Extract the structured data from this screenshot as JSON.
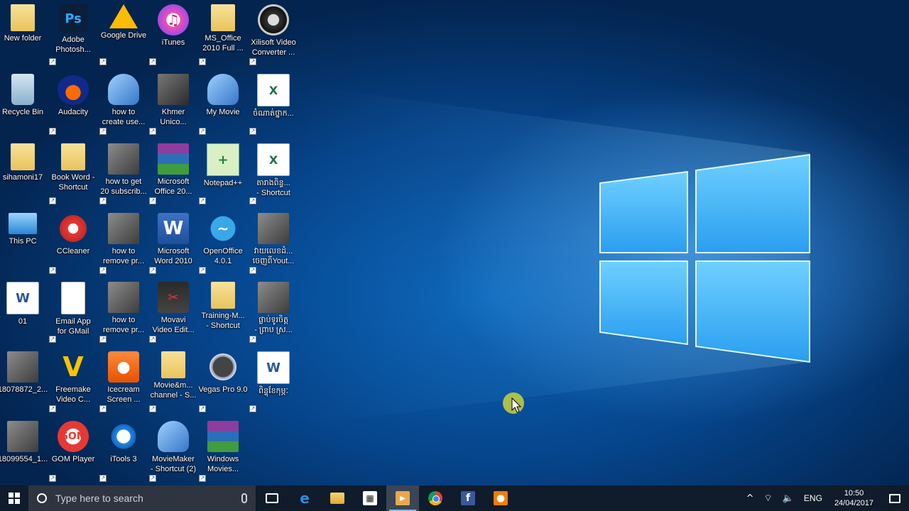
{
  "desktop": {
    "icons": [
      {
        "label": "New folder",
        "icon": "folder-icon",
        "glyph": ""
      },
      {
        "label": "Adobe\nPhotosh...",
        "icon": "photoshop-icon",
        "glyph": "Ps"
      },
      {
        "label": "Google Drive",
        "icon": "google-drive-icon",
        "glyph": ""
      },
      {
        "label": "iTunes",
        "icon": "itunes-icon",
        "glyph": "♫"
      },
      {
        "label": "MS_Office\n2010 Full ...",
        "icon": "folder-icon",
        "glyph": ""
      },
      {
        "label": "Xilisoft Video\nConverter ...",
        "icon": "film-reel-icon",
        "glyph": ""
      },
      {
        "label": "Recycle Bin",
        "icon": "recycle-bin-icon",
        "glyph": ""
      },
      {
        "label": "Audacity",
        "icon": "audacity-icon",
        "glyph": ""
      },
      {
        "label": "how to\ncreate use...",
        "icon": "moviemaker-icon",
        "glyph": ""
      },
      {
        "label": "Khmer\nUnico...",
        "icon": "keyboard-photo-icon",
        "glyph": ""
      },
      {
        "label": "My Movie",
        "icon": "moviemaker-icon",
        "glyph": ""
      },
      {
        "label": "ចំណាត់ថ្នាក...",
        "icon": "excel-file-icon",
        "glyph": "X"
      },
      {
        "label": "sihamoni17",
        "icon": "folder-icon",
        "glyph": ""
      },
      {
        "label": "Book Word -\nShortcut",
        "icon": "folder-icon",
        "glyph": ""
      },
      {
        "label": "how to get\n20 subscrib...",
        "icon": "video-file-icon",
        "glyph": ""
      },
      {
        "label": "Microsoft\nOffice 20...",
        "icon": "winrar-icon",
        "glyph": ""
      },
      {
        "label": "Notepad++",
        "icon": "notepad-plus-icon",
        "glyph": "+"
      },
      {
        "label": "តារាងពិន្ទ...\n- Shortcut",
        "icon": "excel-file-icon",
        "glyph": "X"
      },
      {
        "label": "This PC",
        "icon": "computer-icon",
        "glyph": ""
      },
      {
        "label": "CCleaner",
        "icon": "ccleaner-icon",
        "glyph": ""
      },
      {
        "label": "how to\nremove pr...",
        "icon": "video-file-icon",
        "glyph": ""
      },
      {
        "label": "Microsoft\nWord 2010",
        "icon": "word-icon",
        "glyph": "W"
      },
      {
        "label": "OpenOffice\n4.0.1",
        "icon": "openoffice-icon",
        "glyph": "~"
      },
      {
        "label": "វាយលេខដំ...\nចេញពីYout...",
        "icon": "video-file-icon",
        "glyph": ""
      },
      {
        "label": "01",
        "icon": "word-file-icon",
        "glyph": "W"
      },
      {
        "label": "Email App\nfor GMail",
        "icon": "blank-file-icon",
        "glyph": ""
      },
      {
        "label": "how to\nremove pr...",
        "icon": "video-file-icon",
        "glyph": ""
      },
      {
        "label": "Movavi\nVideo Edit...",
        "icon": "movavi-icon",
        "glyph": "✂"
      },
      {
        "label": "Training-M...\n- Shortcut",
        "icon": "folder-icon",
        "glyph": ""
      },
      {
        "label": "ផ្លាប់ទូរចិត្ត\n- ព្រាប ស្រ...",
        "icon": "video-file-icon",
        "glyph": ""
      },
      {
        "label": "18078872_2...",
        "icon": "video-file-icon",
        "glyph": ""
      },
      {
        "label": "Freemake\nVideo C...",
        "icon": "freemake-icon",
        "glyph": "V"
      },
      {
        "label": "Icecream\nScreen ...",
        "icon": "icecream-icon",
        "glyph": "●"
      },
      {
        "label": "Movie&m...\nchannel - S...",
        "icon": "folder-icon",
        "glyph": ""
      },
      {
        "label": "Vegas Pro 9.0",
        "icon": "vegas-icon",
        "glyph": ""
      },
      {
        "label": "ពិន្ទុខែកុម្ភៈ",
        "icon": "word-file-icon",
        "glyph": "W"
      },
      {
        "label": "18099554_1...",
        "icon": "video-file-icon",
        "glyph": ""
      },
      {
        "label": "GOM Player",
        "icon": "gom-player-icon",
        "glyph": "GOM"
      },
      {
        "label": "iTools 3",
        "icon": "itools-icon",
        "glyph": ""
      },
      {
        "label": "MovieMaker\n- Shortcut (2)",
        "icon": "moviemaker-icon",
        "glyph": ""
      },
      {
        "label": "Windows\nMovies...",
        "icon": "winrar-icon",
        "glyph": ""
      }
    ]
  },
  "taskbar": {
    "search_placeholder": "Type here to search",
    "apps": [
      {
        "name": "task-view-icon",
        "glyph": ""
      },
      {
        "name": "edge-icon",
        "glyph": "e"
      },
      {
        "name": "file-explorer-icon",
        "glyph": ""
      },
      {
        "name": "store-icon",
        "glyph": "▦"
      },
      {
        "name": "media-player-icon",
        "glyph": "▶"
      },
      {
        "name": "chrome-icon",
        "glyph": ""
      },
      {
        "name": "facebook-icon",
        "glyph": "f"
      },
      {
        "name": "icecream-recorder-icon",
        "glyph": "●"
      }
    ],
    "tray": {
      "chevron": "^",
      "network": "⌔",
      "volume": "🔈",
      "language": "ENG",
      "time": "10:50",
      "date": "24/04/2017"
    }
  }
}
